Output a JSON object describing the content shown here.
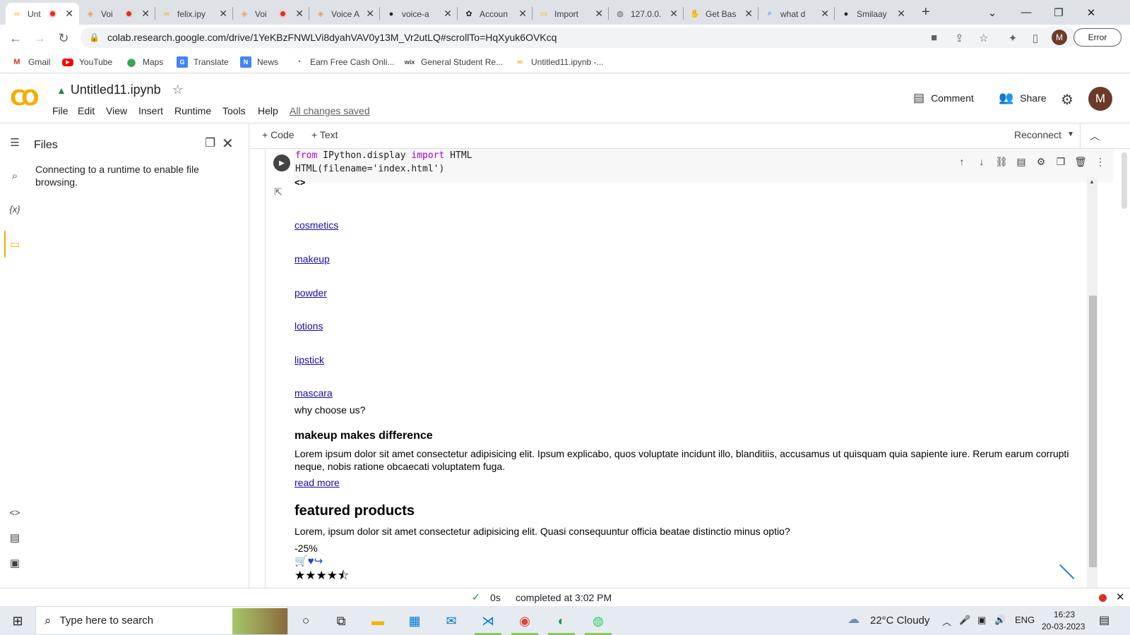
{
  "browser": {
    "tabs": [
      {
        "title": "Unt",
        "icon": "colab-icon",
        "recording": true,
        "active": true
      },
      {
        "title": "Voi",
        "icon": "voice-icon",
        "recording": true
      },
      {
        "title": "felix.ipy",
        "icon": "colab-icon"
      },
      {
        "title": "Voi",
        "icon": "voice-icon",
        "recording": true
      },
      {
        "title": "Voice A",
        "icon": "voice-icon"
      },
      {
        "title": "voice-a",
        "icon": "github-icon"
      },
      {
        "title": "Accoun",
        "icon": "openai-icon"
      },
      {
        "title": "Import",
        "icon": "doc-icon"
      },
      {
        "title": "127.0.0.",
        "icon": "globe-icon"
      },
      {
        "title": "Get Bas",
        "icon": "hand-icon"
      },
      {
        "title": "what d",
        "icon": "search-icon"
      },
      {
        "title": "Smilaay",
        "icon": "github-icon"
      }
    ],
    "new_tab": "+",
    "url": "colab.research.google.com/drive/1YeKBzFNWLVi8dyahVAV0y13M_Vr2utLQ#scrollTo=HqXyuk6OVKcq",
    "profile_initial": "M",
    "error_label": "Error",
    "bookmarks": [
      {
        "label": "Gmail",
        "icon": "gmail-icon"
      },
      {
        "label": "YouTube",
        "icon": "youtube-icon"
      },
      {
        "label": "Maps",
        "icon": "maps-icon"
      },
      {
        "label": "Translate",
        "icon": "translate-icon"
      },
      {
        "label": "News",
        "icon": "news-icon"
      },
      {
        "label": "Earn Free Cash Onli...",
        "icon": "cash-icon"
      },
      {
        "label": "General Student Re...",
        "icon": "wix-icon"
      },
      {
        "label": "Untitled11.ipynb -...",
        "icon": "colab-icon"
      }
    ]
  },
  "colab": {
    "logo": "CO",
    "notebook_name": "Untitled11.ipynb",
    "menu": [
      "File",
      "Edit",
      "View",
      "Insert",
      "Runtime",
      "Tools",
      "Help"
    ],
    "saved_status": "All changes saved",
    "comment_label": "Comment",
    "share_label": "Share",
    "user_initial": "M",
    "files_title": "Files",
    "files_message": "Connecting to a runtime to enable file browsing.",
    "add_code": "+ Code",
    "add_text": "+ Text",
    "reconnect": "Reconnect"
  },
  "cell": {
    "code_line1_kw1": "from",
    "code_line1_mid": " IPython.display ",
    "code_line1_kw2": "import",
    "code_line1_end": " HTML",
    "code_line2": "HTML(filename='index.html')"
  },
  "output": {
    "toggle": "<>",
    "links": [
      "cosmetics",
      "makeup",
      "powder",
      "lotions",
      "lipstick",
      "mascara"
    ],
    "why": "why choose us?",
    "heading1": "makeup makes difference",
    "para1_line1": "Lorem ipsum dolor sit amet consectetur adipisicing elit. Ipsum explicabo, quos voluptate incidunt illo, blanditiis, accusamus ut quisquam quia sapiente iure. Rerum earum corrupti",
    "para1_line2": "neque, nobis ratione obcaecati voluptatem fuga.",
    "read_more": "read more",
    "heading2": "featured products",
    "para2": "Lorem, ipsum dolor sit amet consectetur adipisicing elit. Quasi consequuntur officia beatae distinctio minus optio?",
    "discount": "-25%"
  },
  "status": {
    "duration": "0s",
    "completed": "completed at 3:02 PM"
  },
  "taskbar": {
    "search_placeholder": "Type here to search",
    "weather": "22°C  Cloudy",
    "language": "ENG",
    "time": "16:23",
    "date": "20-03-2023"
  }
}
